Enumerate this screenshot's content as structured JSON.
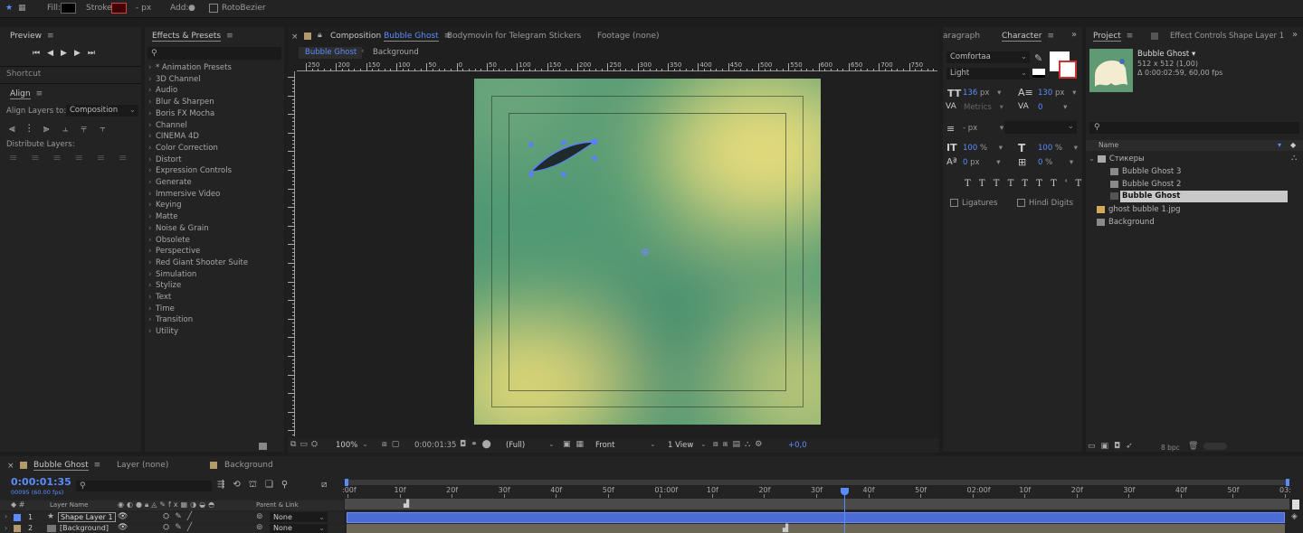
{
  "toolbar": {
    "fill_label": "Fill:",
    "stroke_label": "Stroke:",
    "stroke_px": "- px",
    "add_label": "Add:",
    "rotobezier_label": "RotoBezier"
  },
  "preview": {
    "title": "Preview"
  },
  "shortcut": {
    "title": "Shortcut"
  },
  "align": {
    "title": "Align",
    "align_layers_to": "Align Layers to:",
    "target": "Composition",
    "distribute": "Distribute Layers:"
  },
  "effects": {
    "title": "Effects & Presets",
    "items": [
      "* Animation Presets",
      "3D Channel",
      "Audio",
      "Blur & Sharpen",
      "Boris FX Mocha",
      "Channel",
      "CINEMA 4D",
      "Color Correction",
      "Distort",
      "Expression Controls",
      "Generate",
      "Immersive Video",
      "Keying",
      "Matte",
      "Noise & Grain",
      "Obsolete",
      "Perspective",
      "Red Giant Shooter Suite",
      "Simulation",
      "Stylize",
      "Text",
      "Time",
      "Transition",
      "Utility"
    ]
  },
  "comp": {
    "tab_prefix": "Composition",
    "tab_name": "Bubble Ghost",
    "tab2": "Bodymovin for Telegram Stickers",
    "tab3": "Footage (none)",
    "crumb_active": "Bubble Ghost",
    "crumb_next": "Background",
    "ruler": [
      "250",
      "200",
      "150",
      "100",
      "50",
      "0",
      "50",
      "100",
      "150",
      "200",
      "250",
      "300",
      "350",
      "400",
      "450",
      "500",
      "550",
      "600",
      "650",
      "700",
      "750"
    ],
    "zoom": "100%",
    "timecode": "0:00:01:35",
    "resolution": "(Full)",
    "view": "Front",
    "views": "1 View",
    "exposure": "+0,0"
  },
  "character": {
    "tab_paragraph": "aragraph",
    "tab_character": "Character",
    "font": "Comfortaa",
    "style": "Light",
    "size": "136",
    "size_unit": "px",
    "leading": "130",
    "leading_unit": "px",
    "kerning": "Metrics",
    "tracking": "0",
    "stroke": "- px",
    "vscale": "100",
    "hscale": "100",
    "baseline": "0",
    "baseline_unit": "px",
    "tsume": "0",
    "pct": "%",
    "ligatures": "Ligatures",
    "hindi": "Hindi Digits"
  },
  "project": {
    "tab": "Project",
    "tab2": "Effect Controls Shape Layer 1",
    "comp_name": "Bubble Ghost",
    "comp_size": "512 x 512 (1,00)",
    "comp_duration": "Δ 0:00:02:59, 60,00 fps",
    "col_name": "Name",
    "folder": "Стикеры",
    "items": [
      "Bubble Ghost 3",
      "Bubble Ghost 2",
      "Bubble Ghost"
    ],
    "file": "ghost bubble 1.jpg",
    "bg": "Background",
    "bpc": "8 bpc"
  },
  "timeline": {
    "tab": "Bubble Ghost",
    "tab_layer": "Layer (none)",
    "tab_bg": "Background",
    "timecode": "0:00:01:35",
    "frames": "00095 (60.00 fps)",
    "col_layer": "Layer Name",
    "col_parent": "Parent & Link",
    "ticks": [
      ":00f",
      "10f",
      "20f",
      "30f",
      "40f",
      "50f",
      "01:00f",
      "10f",
      "20f",
      "30f",
      "40f",
      "50f",
      "02:00f",
      "10f",
      "20f",
      "30f",
      "40f",
      "50f",
      "03:"
    ],
    "layers": [
      {
        "num": "1",
        "name": "Shape Layer 1",
        "parent": "None"
      },
      {
        "num": "2",
        "name": "[Background]",
        "parent": "None"
      }
    ],
    "playhead_fraction": 0.53
  },
  "colors": {
    "accent": "#5b8cff",
    "layer_bar": "#4a6cd4",
    "gradient_green": "#3f8f6f",
    "gradient_yellow": "#e3dc7a"
  }
}
